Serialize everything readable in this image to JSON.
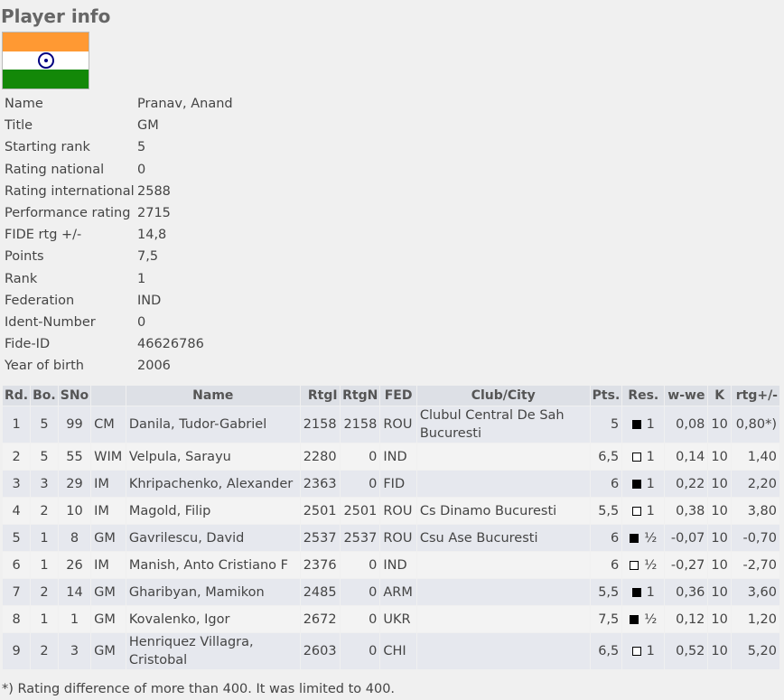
{
  "page": {
    "title": "Player info"
  },
  "flag": {
    "country": "IND",
    "colors": [
      "#ff9933",
      "#ffffff",
      "#138808"
    ],
    "wheel_color": "#000080"
  },
  "player": [
    {
      "label": "Name",
      "value": "Pranav, Anand"
    },
    {
      "label": "Title",
      "value": "GM"
    },
    {
      "label": "Starting rank",
      "value": "5"
    },
    {
      "label": "Rating national",
      "value": "0"
    },
    {
      "label": "Rating international",
      "value": "2588"
    },
    {
      "label": "Performance rating",
      "value": "2715"
    },
    {
      "label": "FIDE rtg +/-",
      "value": "14,8"
    },
    {
      "label": "Points",
      "value": "7,5"
    },
    {
      "label": "Rank",
      "value": "1"
    },
    {
      "label": "Federation",
      "value": "IND"
    },
    {
      "label": "Ident-Number",
      "value": "0"
    },
    {
      "label": "Fide-ID",
      "value": "46626786"
    },
    {
      "label": "Year of birth",
      "value": "2006"
    }
  ],
  "games": {
    "headers": [
      "Rd.",
      "Bo.",
      "SNo",
      "",
      "Name",
      "RtgI",
      "RtgN",
      "FED",
      "Club/City",
      "Pts.",
      "Res.",
      "w-we",
      "K",
      "rtg+/-"
    ],
    "rows": [
      {
        "rd": "1",
        "bo": "5",
        "sno": "99",
        "title": "CM",
        "name": "Danila, Tudor-Gabriel",
        "rtgi": "2158",
        "rtgn": "2158",
        "fed": "ROU",
        "club": "Clubul Central De Sah Bucuresti",
        "pts": "5",
        "color": "black",
        "res": "1",
        "wwe": "0,08",
        "k": "10",
        "rtg": "0,80*)"
      },
      {
        "rd": "2",
        "bo": "5",
        "sno": "55",
        "title": "WIM",
        "name": "Velpula, Sarayu",
        "rtgi": "2280",
        "rtgn": "0",
        "fed": "IND",
        "club": "",
        "pts": "6,5",
        "color": "white",
        "res": "1",
        "wwe": "0,14",
        "k": "10",
        "rtg": "1,40"
      },
      {
        "rd": "3",
        "bo": "3",
        "sno": "29",
        "title": "IM",
        "name": "Khripachenko, Alexander",
        "rtgi": "2363",
        "rtgn": "0",
        "fed": "FID",
        "club": "",
        "pts": "6",
        "color": "black",
        "res": "1",
        "wwe": "0,22",
        "k": "10",
        "rtg": "2,20"
      },
      {
        "rd": "4",
        "bo": "2",
        "sno": "10",
        "title": "IM",
        "name": "Magold, Filip",
        "rtgi": "2501",
        "rtgn": "2501",
        "fed": "ROU",
        "club": "Cs Dinamo Bucuresti",
        "pts": "5,5",
        "color": "white",
        "res": "1",
        "wwe": "0,38",
        "k": "10",
        "rtg": "3,80"
      },
      {
        "rd": "5",
        "bo": "1",
        "sno": "8",
        "title": "GM",
        "name": "Gavrilescu, David",
        "rtgi": "2537",
        "rtgn": "2537",
        "fed": "ROU",
        "club": "Csu Ase Bucuresti",
        "pts": "6",
        "color": "black",
        "res": "½",
        "wwe": "-0,07",
        "k": "10",
        "rtg": "-0,70"
      },
      {
        "rd": "6",
        "bo": "1",
        "sno": "26",
        "title": "IM",
        "name": "Manish, Anto Cristiano F",
        "rtgi": "2376",
        "rtgn": "0",
        "fed": "IND",
        "club": "",
        "pts": "6",
        "color": "white",
        "res": "½",
        "wwe": "-0,27",
        "k": "10",
        "rtg": "-2,70"
      },
      {
        "rd": "7",
        "bo": "2",
        "sno": "14",
        "title": "GM",
        "name": "Gharibyan, Mamikon",
        "rtgi": "2485",
        "rtgn": "0",
        "fed": "ARM",
        "club": "",
        "pts": "5,5",
        "color": "black",
        "res": "1",
        "wwe": "0,36",
        "k": "10",
        "rtg": "3,60"
      },
      {
        "rd": "8",
        "bo": "1",
        "sno": "1",
        "title": "GM",
        "name": "Kovalenko, Igor",
        "rtgi": "2672",
        "rtgn": "0",
        "fed": "UKR",
        "club": "",
        "pts": "7,5",
        "color": "black",
        "res": "½",
        "wwe": "0,12",
        "k": "10",
        "rtg": "1,20"
      },
      {
        "rd": "9",
        "bo": "2",
        "sno": "3",
        "title": "GM",
        "name": "Henriquez Villagra, Cristobal",
        "rtgi": "2603",
        "rtgn": "0",
        "fed": "CHI",
        "club": "",
        "pts": "6,5",
        "color": "white",
        "res": "1",
        "wwe": "0,52",
        "k": "10",
        "rtg": "5,20"
      }
    ]
  },
  "footnote": "*) Rating difference of more than 400. It was limited to 400."
}
